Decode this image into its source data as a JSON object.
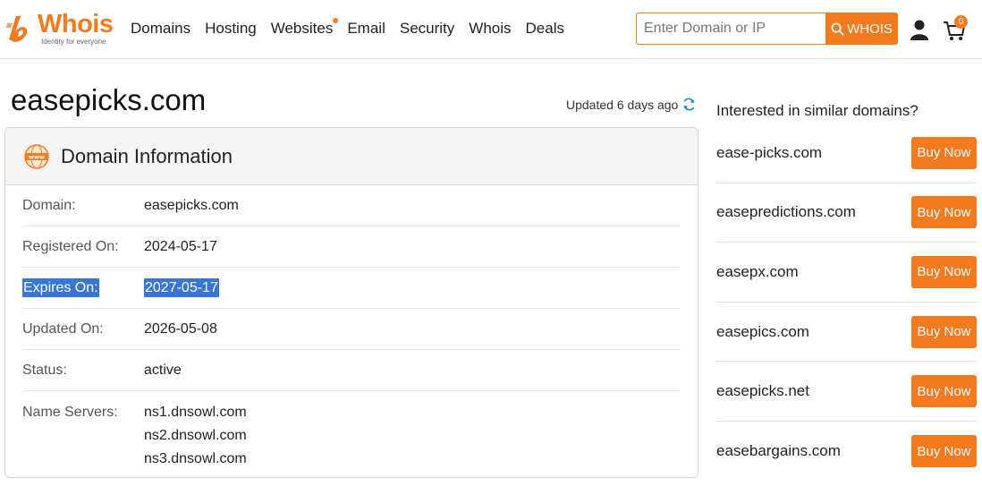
{
  "brand": {
    "name": "Whois",
    "tagline": "Identity for everyone",
    "accent": "#f47a20"
  },
  "nav": {
    "items": [
      {
        "label": "Domains"
      },
      {
        "label": "Hosting"
      },
      {
        "label": "Websites"
      },
      {
        "label": "Email"
      },
      {
        "label": "Security"
      },
      {
        "label": "Whois"
      },
      {
        "label": "Deals"
      }
    ]
  },
  "search": {
    "placeholder": "Enter Domain or IP",
    "button_label": "WHOIS"
  },
  "cart": {
    "count": "0"
  },
  "page": {
    "title": "easepicks.com",
    "updated_text": "Updated 6 days ago"
  },
  "domain_info": {
    "heading": "Domain Information",
    "icon_text": "www",
    "rows": [
      {
        "label": "Domain:",
        "value": "easepicks.com"
      },
      {
        "label": "Registered On:",
        "value": "2024-05-17"
      },
      {
        "label": "Expires On:",
        "value": "2027-05-17"
      },
      {
        "label": "Updated On:",
        "value": "2026-05-08"
      },
      {
        "label": "Status:",
        "value": "active"
      }
    ],
    "name_servers": {
      "label": "Name Servers:",
      "values": [
        "ns1.dnsowl.com",
        "ns2.dnsowl.com",
        "ns3.dnsowl.com"
      ]
    }
  },
  "similar": {
    "title": "Interested in similar domains?",
    "button_label": "Buy Now",
    "domains": [
      {
        "name": "ease-picks.com"
      },
      {
        "name": "easepredictions.com"
      },
      {
        "name": "easepx.com"
      },
      {
        "name": "easepics.com"
      },
      {
        "name": "easepicks.net"
      },
      {
        "name": "easebargains.com"
      }
    ]
  }
}
